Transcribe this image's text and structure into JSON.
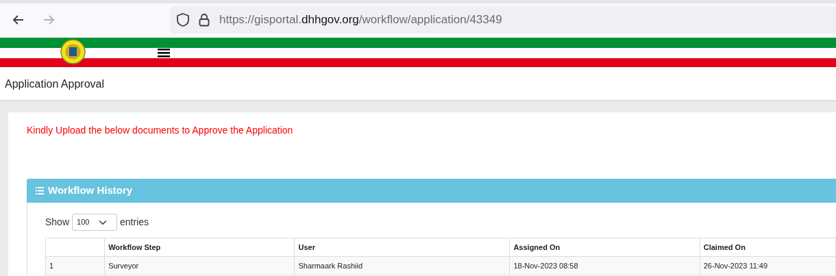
{
  "browser": {
    "nav_buttons": [
      {
        "kind": "back",
        "disabled": false
      },
      {
        "kind": "forward",
        "disabled": true
      }
    ],
    "url": {
      "prefix": "https://gisportal.",
      "domain": "dhhgov.org",
      "path": "/workflow/application/43349"
    }
  },
  "page": {
    "title": "Application Approval",
    "notice": "Kindly Upload the below documents to Approve the Application"
  },
  "panel": {
    "title": "Workflow History",
    "show_label": "Show",
    "page_size": "100",
    "entries_label": "entries",
    "table": {
      "columns": [
        "",
        "Workflow Step",
        "User",
        "Assigned On",
        "Claimed On"
      ],
      "rows": [
        [
          "1",
          "Surveyor",
          "Sharmaark Rashiid",
          "18-Nov-2023 08:58",
          "26-Nov-2023 11:49"
        ]
      ]
    }
  }
}
